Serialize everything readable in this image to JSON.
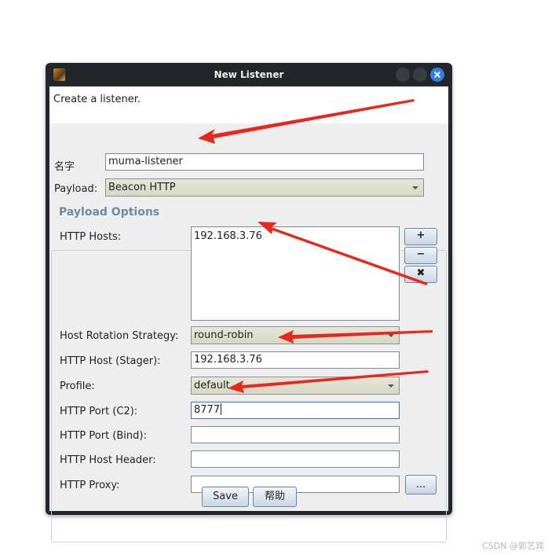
{
  "window": {
    "title": "New Listener"
  },
  "description": "Create a listener.",
  "form": {
    "name_label": "名字",
    "name_value": "muma-listener",
    "payload_label": "Payload:",
    "payload_value": "Beacon HTTP"
  },
  "payload_options": {
    "title": "Payload Options",
    "http_hosts_label": "HTTP Hosts:",
    "http_hosts_value": "192.168.3.76",
    "add_button": "+",
    "remove_button": "−",
    "clear_button": "✖",
    "rotation_label": "Host Rotation Strategy:",
    "rotation_value": "round-robin",
    "stager_label": "HTTP Host (Stager):",
    "stager_value": "192.168.3.76",
    "profile_label": "Profile:",
    "profile_value": "default",
    "port_c2_label": "HTTP Port (C2):",
    "port_c2_value": "8777",
    "port_bind_label": "HTTP Port (Bind):",
    "port_bind_value": "",
    "host_header_label": "HTTP Host Header:",
    "host_header_value": "",
    "proxy_label": "HTTP Proxy:",
    "proxy_value": "",
    "proxy_button": "..."
  },
  "buttons": {
    "save": "Save",
    "help": "帮助"
  },
  "watermark": "CSDN @郭艺宾",
  "colors": {
    "annotation_arrow": "#e8281e",
    "close_button": "#2f7fe6",
    "group_title": "#6b8aa8"
  }
}
